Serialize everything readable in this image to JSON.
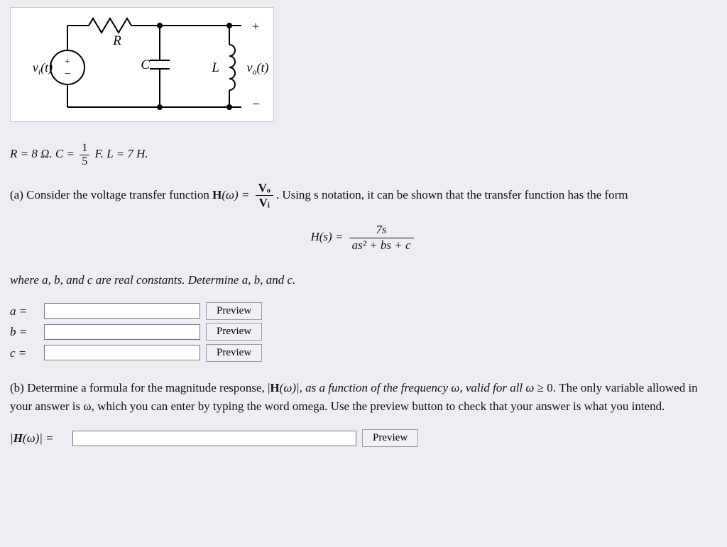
{
  "circuit": {
    "vi_label": "vᵢ(t)",
    "vo_label": "vₒ(t)",
    "R_label": "R",
    "C_label": "C",
    "L_label": "L",
    "pos": "+",
    "neg": "−"
  },
  "params": {
    "R_text": "R = 8 Ω. C = ",
    "frac_top": "1",
    "frac_bot": "5",
    "L_text": " F. L = 7 H."
  },
  "partA": {
    "intro1": "(a) Consider the voltage transfer function ",
    "H_label": "H",
    "omega_arg": "(ω) = ",
    "ratio_top": "Vₒ",
    "ratio_bot": "Vᵢ",
    "intro2": ". Using s notation, it can be shown that the transfer function has the form",
    "Hs_left": "H(s) = ",
    "Hs_top": "7s",
    "Hs_bot": "as² + bs + c",
    "where_text": "where a, b, and c are real constants. Determine a, b, and c.",
    "a_label": "a =",
    "b_label": "b =",
    "c_label": "c =",
    "preview": "Preview"
  },
  "partB": {
    "text1": "(b) Determine a formula for the magnitude response, |",
    "H_label": "H",
    "text2": "(ω)|, as a function of the frequency ω, valid for all ω ",
    "ge": "≥",
    "text3": " 0. The only variable allowed in your answer is ω, which you can enter by typing the word omega. Use the preview button to check that your answer is what you intend.",
    "mag_label": "|H(ω)| =",
    "preview": "Preview"
  }
}
